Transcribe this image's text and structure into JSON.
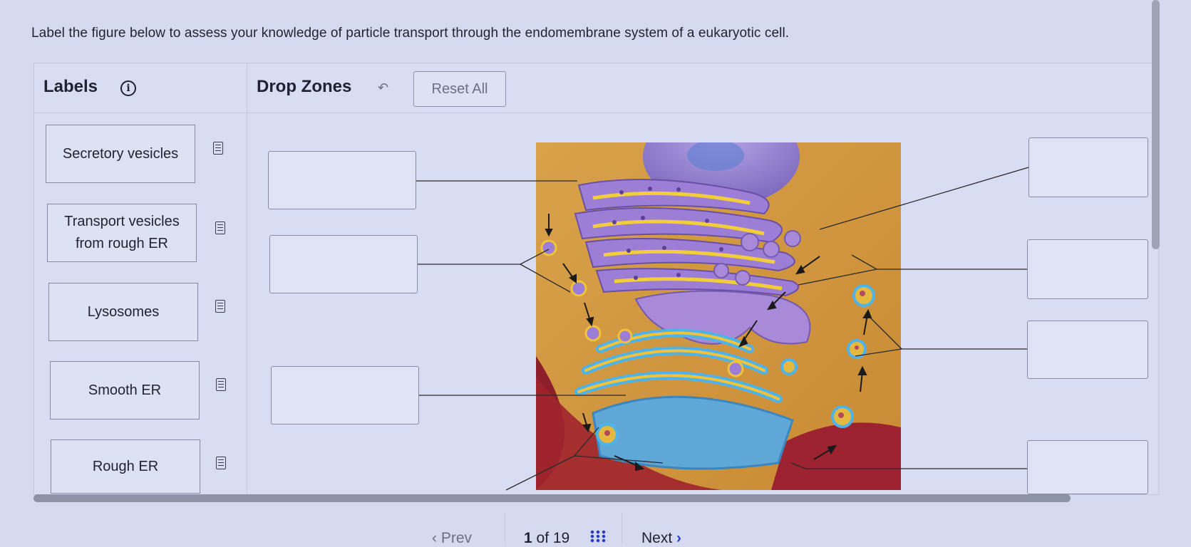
{
  "prompt": "Label the figure below to assess your knowledge of particle transport through the endomembrane system of a eukaryotic cell.",
  "labels_panel": {
    "title": "Labels",
    "info_icon": "info-circle-icon",
    "items": [
      {
        "text": "Secretory vesicles",
        "icon": "notes-icon"
      },
      {
        "text": "Transport vesicles\nfrom rough ER",
        "icon": "notes-icon"
      },
      {
        "text": "Lysosomes",
        "icon": "notes-icon"
      },
      {
        "text": "Smooth ER",
        "icon": "notes-icon"
      },
      {
        "text": "Rough ER",
        "icon": "notes-icon"
      }
    ]
  },
  "drop_zones_panel": {
    "title": "Drop Zones",
    "undo_icon": "undo-arrow-icon",
    "reset_label": "Reset All"
  },
  "pagination": {
    "prev_label": "Prev",
    "current": "1",
    "of_label": "of 19",
    "next_label": "Next",
    "grid_icon": "grid-icon"
  },
  "colors": {
    "background": "#d6daf0",
    "accent": "#2b3bbf",
    "golgi_blue": "#5ab8e6",
    "er_purple": "#8a6fc9",
    "cytoplasm": "#d9a046"
  }
}
